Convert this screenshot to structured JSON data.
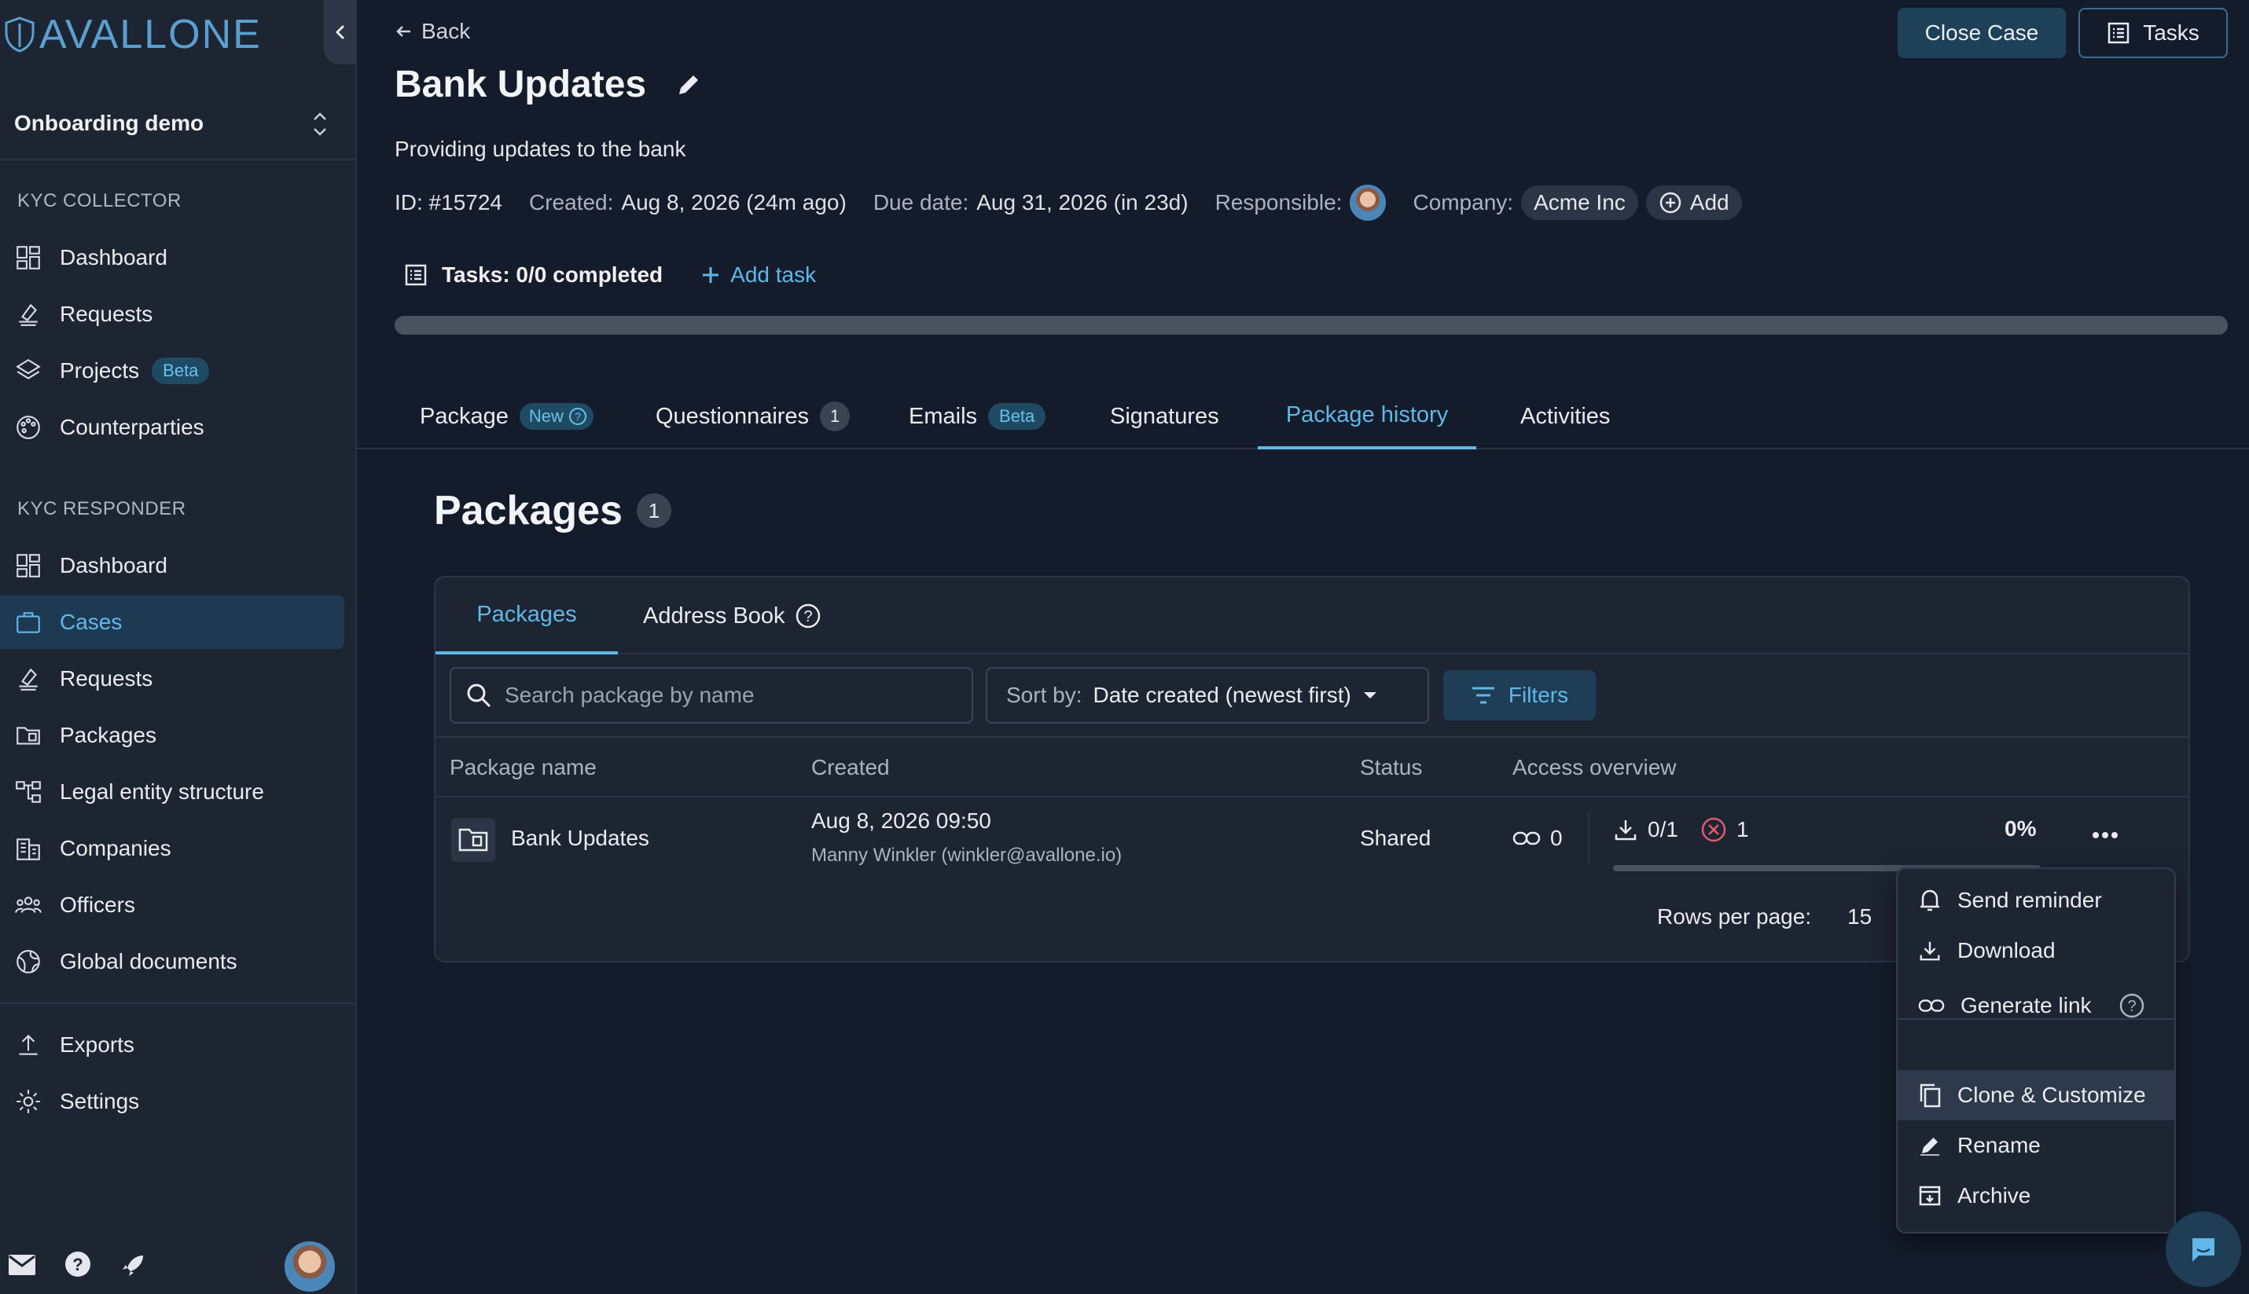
{
  "brand": {
    "name": "AVALLONE",
    "color": "#5a9fd0"
  },
  "workspace": {
    "name": "Onboarding demo"
  },
  "sidebar": {
    "sections": [
      {
        "label": "KYC COLLECTOR",
        "items": [
          {
            "label": "Dashboard",
            "icon": "dashboard-icon"
          },
          {
            "label": "Requests",
            "icon": "requests-icon"
          },
          {
            "label": "Projects",
            "icon": "layers-icon",
            "badge": "Beta"
          },
          {
            "label": "Counterparties",
            "icon": "palette-icon"
          }
        ]
      },
      {
        "label": "KYC RESPONDER",
        "items": [
          {
            "label": "Dashboard",
            "icon": "dashboard-icon"
          },
          {
            "label": "Cases",
            "icon": "briefcase-icon",
            "active": true
          },
          {
            "label": "Requests",
            "icon": "requests-icon"
          },
          {
            "label": "Packages",
            "icon": "folder-icon"
          },
          {
            "label": "Legal entity structure",
            "icon": "hierarchy-icon"
          },
          {
            "label": "Companies",
            "icon": "building-icon"
          },
          {
            "label": "Officers",
            "icon": "people-icon"
          },
          {
            "label": "Global documents",
            "icon": "globe-icon"
          }
        ]
      }
    ],
    "bottom_items": [
      {
        "label": "Exports",
        "icon": "upload-icon"
      },
      {
        "label": "Settings",
        "icon": "gear-icon"
      }
    ]
  },
  "header": {
    "back_label": "Back",
    "close_case_label": "Close Case",
    "tasks_label": "Tasks",
    "title": "Bank Updates",
    "subtitle": "Providing updates to the bank",
    "meta": {
      "id": "ID: #15724",
      "created_key": "Created:",
      "created_val": "Aug 8, 2026 (24m ago)",
      "due_key": "Due date:",
      "due_val": "Aug 31, 2026 (in 23d)",
      "responsible_key": "Responsible:",
      "company_key": "Company:",
      "company_chip": "Acme Inc",
      "add_label": "Add"
    },
    "tasks_summary": "Tasks: 0/0 completed",
    "add_task_label": "Add task",
    "progress": 0
  },
  "main_tabs": [
    {
      "label": "Package",
      "badge": "New"
    },
    {
      "label": "Questionnaires",
      "count": "1"
    },
    {
      "label": "Emails",
      "badge": "Beta"
    },
    {
      "label": "Signatures"
    },
    {
      "label": "Package history",
      "active": true
    },
    {
      "label": "Activities"
    }
  ],
  "packages": {
    "title": "Packages",
    "count": "1",
    "tabs": [
      {
        "label": "Packages",
        "active": true
      },
      {
        "label": "Address Book"
      }
    ],
    "search_placeholder": "Search package by name",
    "sort_key": "Sort by:",
    "sort_value": "Date created (newest first)",
    "filters_label": "Filters",
    "columns": {
      "name": "Package name",
      "created": "Created",
      "status": "Status",
      "access": "Access overview"
    },
    "rows": [
      {
        "name": "Bank Updates",
        "created": "Aug 8, 2026 09:50",
        "created_by": "Manny Winkler (winkler@avallone.io)",
        "status": "Shared",
        "links": "0",
        "downloads": "0/1",
        "rejected": "1",
        "percent": "0%"
      }
    ],
    "rows_per_page_label": "Rows per page:",
    "rows_per_page_value": "15"
  },
  "row_menu": {
    "items": [
      {
        "label": "Send reminder",
        "icon": "bell-icon"
      },
      {
        "label": "Download",
        "icon": "download-icon"
      },
      {
        "label": "Generate link",
        "icon": "link-icon"
      },
      {
        "label": "Clone & Customize",
        "icon": "copy-icon",
        "highlighted": true
      },
      {
        "label": "Rename",
        "icon": "pencil-icon"
      },
      {
        "label": "Archive",
        "icon": "archive-icon"
      }
    ]
  },
  "colors": {
    "accent": "#5fb8e8",
    "background": "#141c2b",
    "sidebar": "#1d2533",
    "danger": "#e05a6a"
  }
}
